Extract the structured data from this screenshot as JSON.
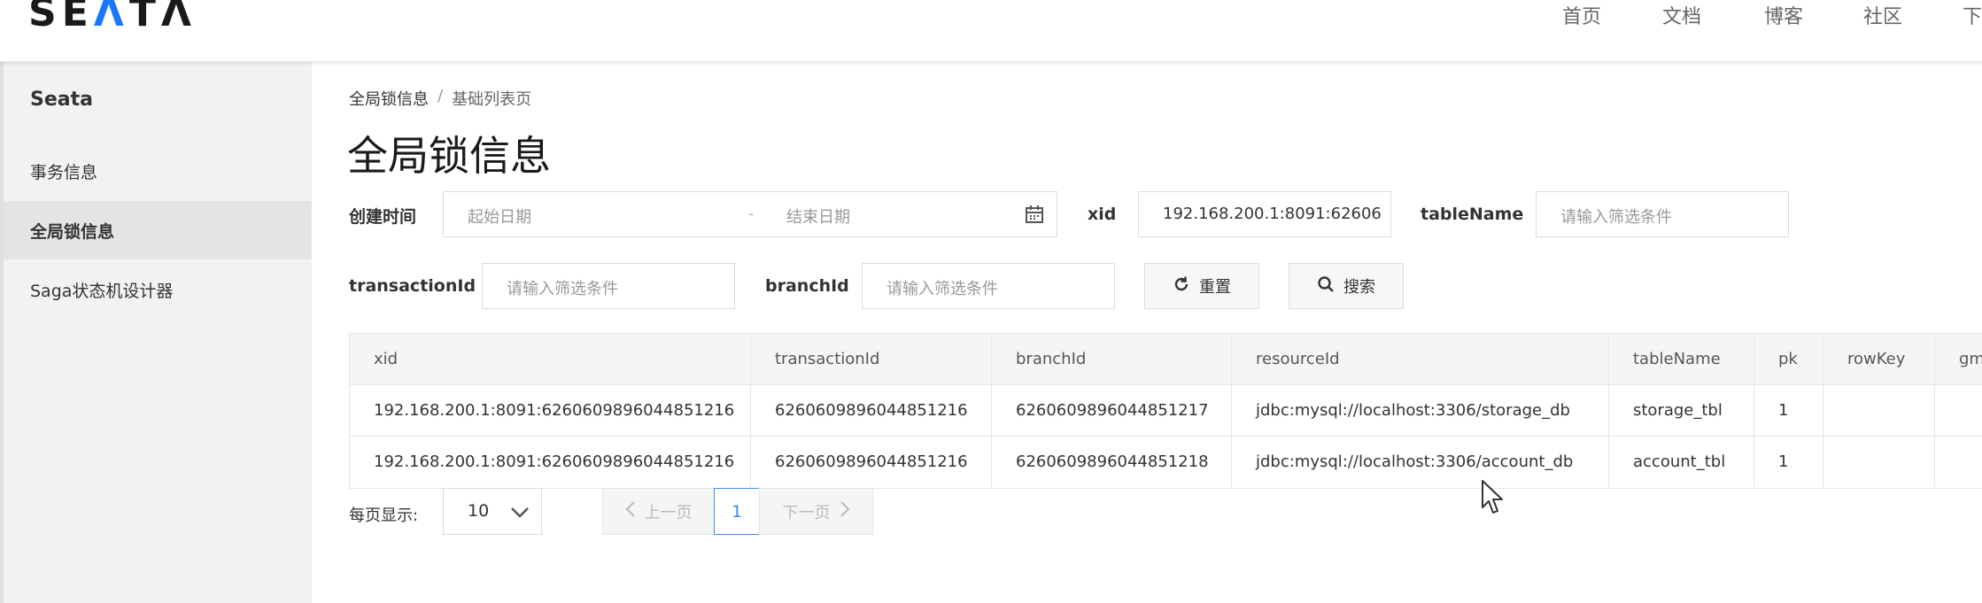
{
  "brand": {
    "logo_text_1": "SE",
    "logo_text_2": "Λ",
    "logo_text_3": "TΛ",
    "accent": "#1a78ff"
  },
  "topnav": [
    "首页",
    "文档",
    "博客",
    "社区",
    "下"
  ],
  "sidebar": {
    "title": "Seata",
    "items": [
      {
        "label": "事务信息",
        "active": false
      },
      {
        "label": "全局锁信息",
        "active": true
      },
      {
        "label": "Saga状态机设计器",
        "active": false
      }
    ]
  },
  "breadcrumb": {
    "root": "全局锁信息",
    "separator": "/",
    "current": "基础列表页"
  },
  "page_title": "全局锁信息",
  "filters": {
    "created_time_label": "创建时间",
    "start_date_placeholder": "起始日期",
    "date_separator": "-",
    "end_date_placeholder": "结束日期",
    "xid_label": "xid",
    "xid_value": "192.168.200.1:8091:62606",
    "tablename_label": "tableName",
    "tablename_placeholder": "请输入筛选条件",
    "transactionid_label": "transactionId",
    "transactionid_placeholder": "请输入筛选条件",
    "branchid_label": "branchId",
    "branchid_placeholder": "请输入筛选条件",
    "reset_label": "重置",
    "search_label": "搜索"
  },
  "table": {
    "columns": [
      "xid",
      "transactionId",
      "branchId",
      "resourceId",
      "tableName",
      "pk",
      "rowKey",
      "gm"
    ],
    "rows": [
      [
        "192.168.200.1:8091:6260609896044851216",
        "6260609896044851216",
        "6260609896044851217",
        "jdbc:mysql://localhost:3306/storage_db",
        "storage_tbl",
        "1",
        "",
        ""
      ],
      [
        "192.168.200.1:8091:6260609896044851216",
        "6260609896044851216",
        "6260609896044851218",
        "jdbc:mysql://localhost:3306/account_db",
        "account_tbl",
        "1",
        "",
        ""
      ]
    ]
  },
  "pagination": {
    "page_size_label": "每页显示:",
    "page_size": "10",
    "prev_label": "上一页",
    "current_page": "1",
    "next_label": "下一页"
  }
}
